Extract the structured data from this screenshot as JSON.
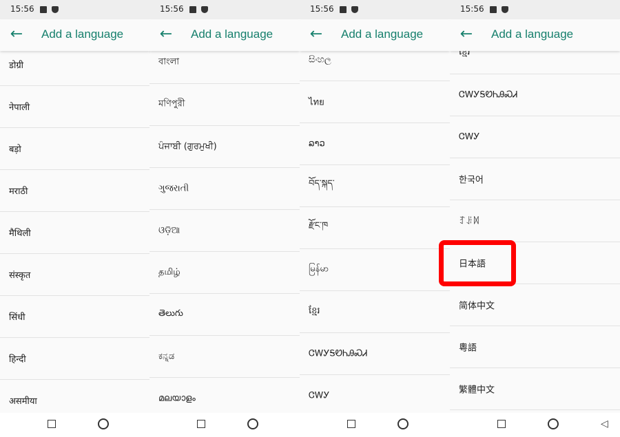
{
  "status_time": "15:56",
  "app_title": "Add a language",
  "back_icon": "arrow-left-icon",
  "accent_color": "#17806d",
  "screens": [
    {
      "items": [
        "डोग्री",
        "नेपाली",
        "बड़ो",
        "मराठी",
        "मैथिली",
        "संस्कृत",
        "सिंधी",
        "हिन्दी",
        "असमीया"
      ]
    },
    {
      "items": [
        "বাংলা",
        "মণিপুরী",
        "ਪੰਜਾਬੀ (ਗੁਰਮੁਖੀ)",
        "ગુજરાતી",
        "ଓଡ଼ିଆ",
        "தமிழ்",
        "తెలుగు",
        "ಕನ್ನಡ",
        "മലയാളം"
      ]
    },
    {
      "items": [
        "සිංහල",
        "ไทย",
        "ລາວ",
        "བོད་སྐད་",
        "རྫོང་ཁ",
        "မြန်မာ",
        "ខ្មែរ",
        "ᏣᎳᎩᎦᏬᏂᎯᏍᏗ",
        "ᏣᎳᎩ"
      ]
    },
    {
      "items": [
        "ខ្មែរ",
        "ᏣᎳᎩᎦᏬᏂᎯᏍᏗ",
        "ᏣᎳᎩ",
        "한국어",
        "ꆈꌠꉙ",
        "日本語",
        "简体中文",
        "粵語",
        "繁體中文"
      ]
    }
  ],
  "highlighted_item": "日本語"
}
